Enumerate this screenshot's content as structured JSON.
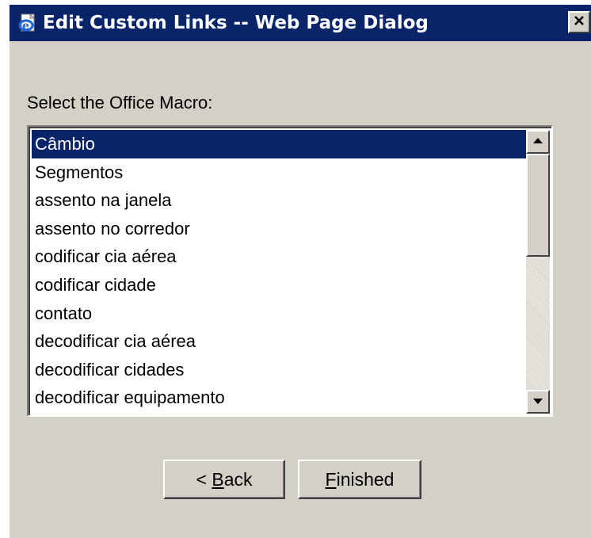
{
  "window": {
    "title": "Edit Custom Links -- Web Page Dialog",
    "titlebar_color": "#0a246a",
    "face_color": "#d4d0c8",
    "icons": [
      "ie-document-icon",
      "close-icon"
    ]
  },
  "prompt": "Select the Office Macro:",
  "macros": {
    "selected_index": 0,
    "selection_color": "#0a246a",
    "items": [
      "Câmbio",
      "Segmentos",
      "assento na janela",
      "assento no corredor",
      "codificar cia aérea",
      "codificar cidade",
      "contato",
      "decodificar cia aérea",
      "decodificar cidades",
      "decodificar equipamento"
    ]
  },
  "buttons": {
    "back": {
      "prefix": "< ",
      "mnemonic": "B",
      "rest": "ack"
    },
    "finished": {
      "mnemonic": "F",
      "rest": "inished"
    }
  }
}
